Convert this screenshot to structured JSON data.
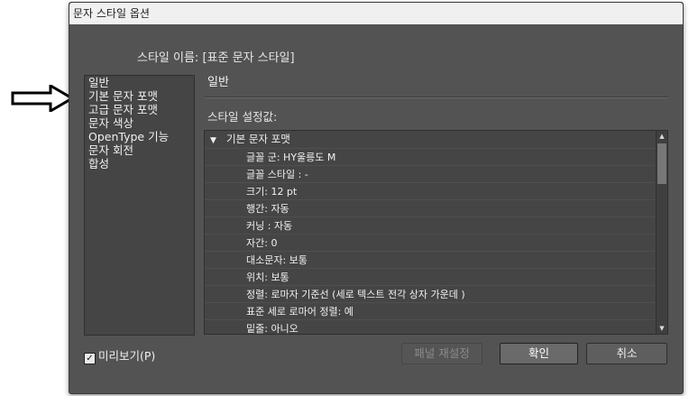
{
  "dialog": {
    "title": "문자 스타일 옵션",
    "style_name": "스타일 이름: [표준 문자 스타일]",
    "categories": [
      {
        "label": "일반",
        "selected": true
      },
      {
        "label": "기본 문자 포맷",
        "selected": false
      },
      {
        "label": "고급 문자 포맷",
        "selected": false
      },
      {
        "label": "문자 색상",
        "selected": false
      },
      {
        "label": "OpenType 기능",
        "selected": false
      },
      {
        "label": "문자 회전",
        "selected": false
      },
      {
        "label": "합성",
        "selected": false
      }
    ],
    "section_title": "일반",
    "settings_label": "스타일 설정값:",
    "tree": {
      "header": "기본 문자 포맷",
      "rows": [
        "글꼴 군: HY울릉도 M",
        "글꼴 스타일 : -",
        "크기: 12 pt",
        "행간: 자동",
        "커닝 : 자동",
        "자간: 0",
        "대소문자: 보통",
        "위치: 보통",
        "정렬: 로마자 기준선 (세로 텍스트 전각 상자 가운데 )",
        "표준 세로 로마어 정렬: 예",
        "밑줄: 아니오"
      ]
    },
    "preview_label": "미리보기(P)",
    "preview_checked": true,
    "buttons": {
      "reset": "패널 재설정",
      "ok": "확인",
      "cancel": "취소"
    },
    "colors": {
      "background": "#535353",
      "panel": "#454545",
      "text": "#e6e6e6"
    }
  },
  "annotation": {
    "icon": "right-arrow-outline-icon"
  }
}
